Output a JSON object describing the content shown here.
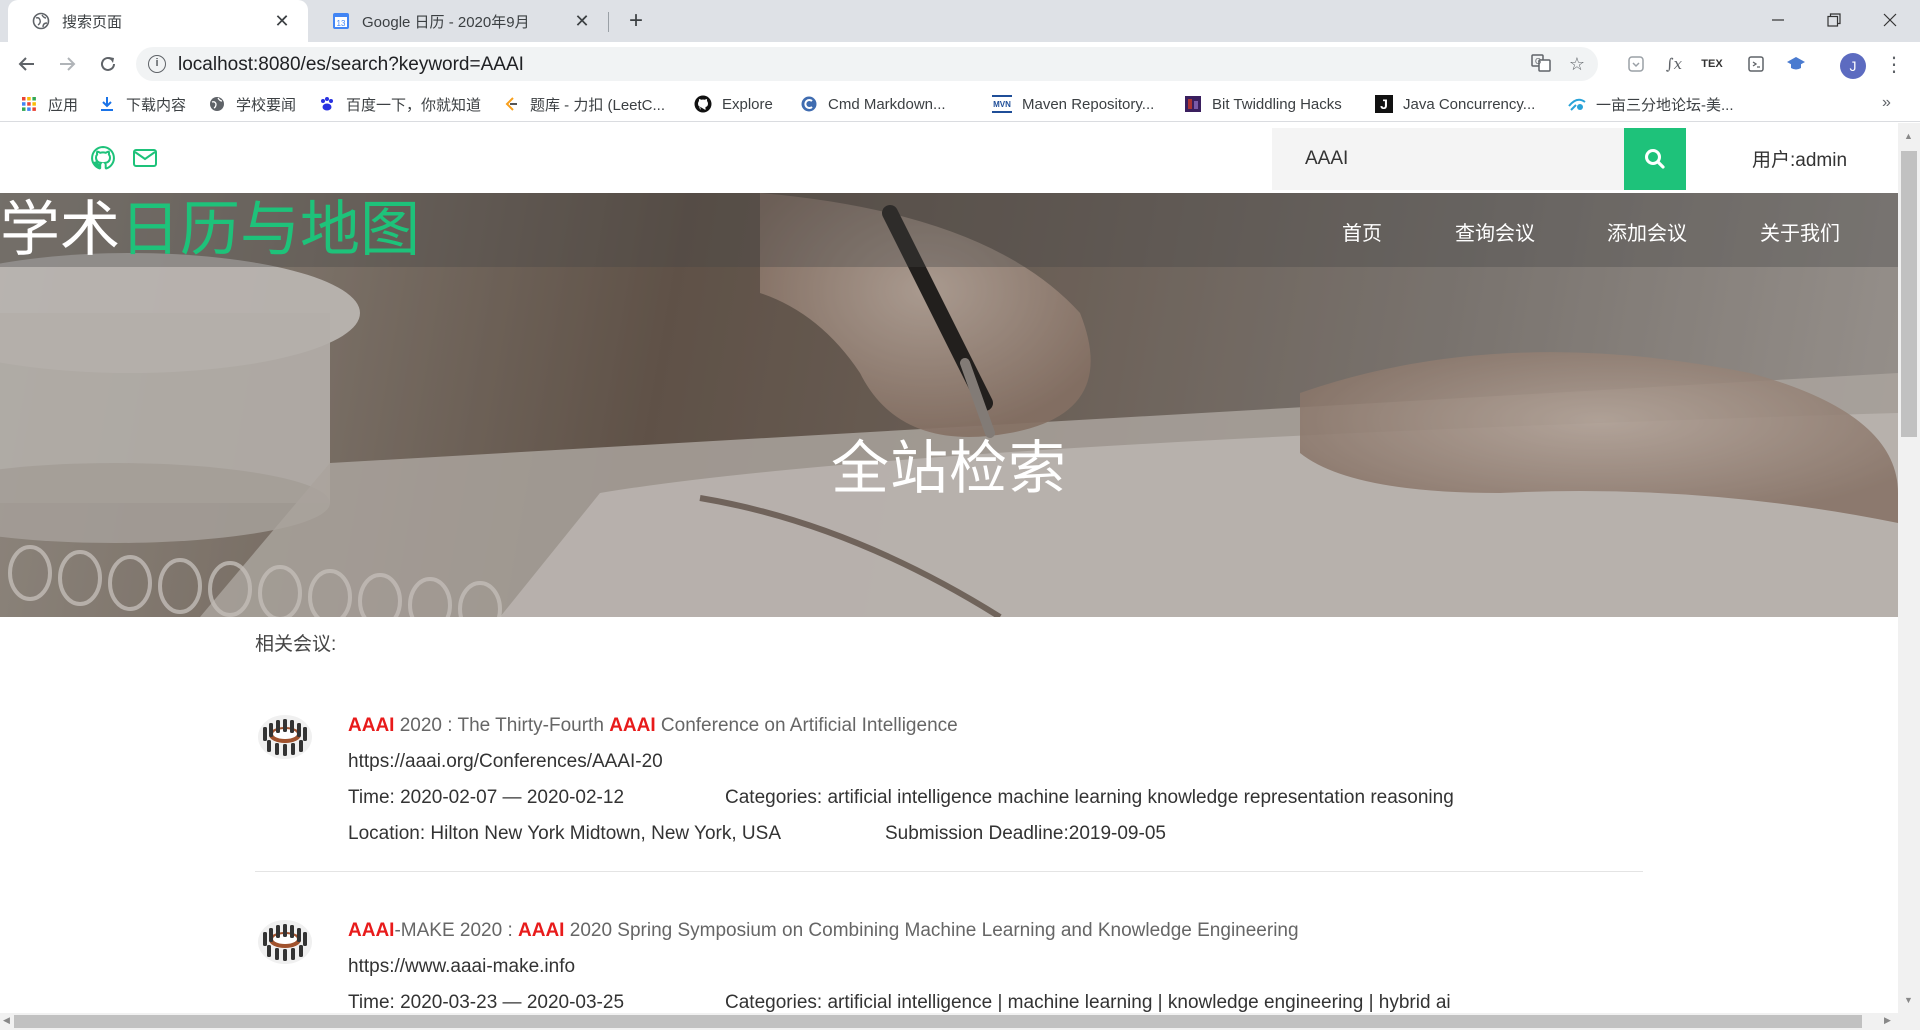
{
  "browser": {
    "tabs": [
      {
        "title": "搜索页面",
        "active": true,
        "icon": "globe-icon"
      },
      {
        "title": "Google 日历 - 2020年9月",
        "active": false,
        "icon": "calendar-icon",
        "icon_text": "13"
      }
    ],
    "new_tab": "+",
    "url": "localhost:8080/es/search?keyword=AAAI",
    "bookmarks": [
      {
        "label": "应用",
        "icon": "apps-grid-icon"
      },
      {
        "label": "下载内容",
        "icon": "download-icon"
      },
      {
        "label": "学校要闻",
        "icon": "globe-icon"
      },
      {
        "label": "百度一下，你就知道",
        "icon": "baidu-paw-icon"
      },
      {
        "label": "题库 - 力扣 (LeetC...",
        "icon": "leetcode-icon"
      },
      {
        "label": "Explore",
        "icon": "github-icon"
      },
      {
        "label": "Cmd Markdown...",
        "icon": "cmd-markdown-icon"
      },
      {
        "label": "Maven Repository...",
        "icon": "maven-icon",
        "icon_text": "MVN"
      },
      {
        "label": "Bit Twiddling Hacks",
        "icon": "bit-twiddling-icon"
      },
      {
        "label": "Java Concurrency...",
        "icon": "java-j-icon",
        "icon_text": "J"
      },
      {
        "label": "一亩三分地论坛-美...",
        "icon": "forum-icon"
      }
    ],
    "extensions": {
      "tex_label": "TEX",
      "avatar_letter": "J"
    }
  },
  "site": {
    "search": {
      "value": "AAAI"
    },
    "user": "用户:admin",
    "logo": {
      "white": "学术",
      "green": "日历与地图"
    },
    "nav": [
      "首页",
      "查询会议",
      "添加会议",
      "关于我们"
    ],
    "hero_title": "全站检索",
    "results_label": "相关会议:",
    "results": [
      {
        "title_parts": [
          {
            "text": "AAAI",
            "hl": true
          },
          {
            "text": " 2020 : The Thirty-Fourth ",
            "hl": false
          },
          {
            "text": "AAAI",
            "hl": true
          },
          {
            "text": " Conference on Artificial Intelligence",
            "hl": false
          }
        ],
        "url": "https://aaai.org/Conferences/AAAI-20",
        "time": "Time: 2020-02-07 — 2020-02-12",
        "categories": "Categories: artificial intelligence machine learning knowledge representation reasoning",
        "location": "Location: Hilton New York Midtown, New York, USA",
        "deadline": "Submission Deadline:2019-09-05"
      },
      {
        "title_parts": [
          {
            "text": "AAAI",
            "hl": true
          },
          {
            "text": "-MAKE 2020 : ",
            "hl": false
          },
          {
            "text": "AAAI",
            "hl": true
          },
          {
            "text": " 2020 Spring Symposium on Combining Machine Learning and Knowledge Engineering",
            "hl": false
          }
        ],
        "url": "https://www.aaai-make.info",
        "time": "Time: 2020-03-23 — 2020-03-25",
        "categories": "Categories: artificial intelligence | machine learning | knowledge engineering | hybrid ai"
      }
    ]
  },
  "colors": {
    "accent": "#1ec27a",
    "highlight": "#e81b1b"
  }
}
